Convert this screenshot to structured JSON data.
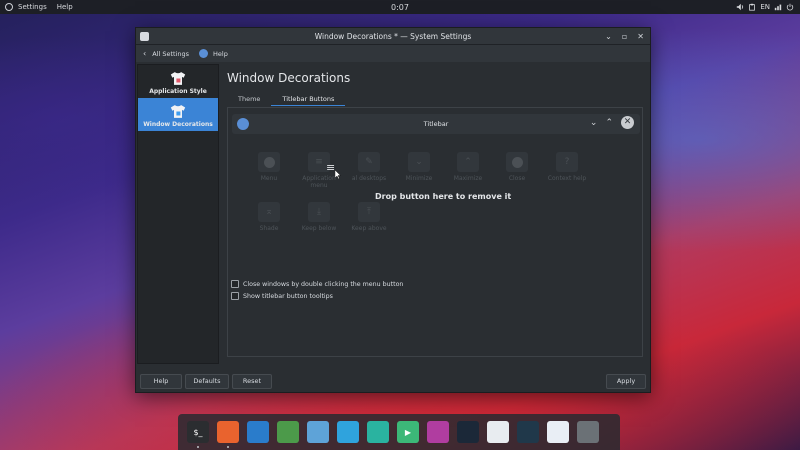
{
  "topbar": {
    "menu_settings": "Settings",
    "menu_help": "Help",
    "clock": "0:07",
    "lang": "EN"
  },
  "window": {
    "title": "Window Decorations * — System Settings",
    "nav_all_settings": "All Settings",
    "nav_help": "Help"
  },
  "sidebar": {
    "items": [
      {
        "label": "Application Style"
      },
      {
        "label": "Window Decorations"
      }
    ]
  },
  "main": {
    "title": "Window Decorations",
    "tabs": [
      {
        "label": "Theme"
      },
      {
        "label": "Titlebar Buttons"
      }
    ],
    "preview_title": "Titlebar",
    "drop_message": "Drop button here to remove it",
    "available_buttons": [
      {
        "label": "Menu"
      },
      {
        "label": "Application\nmenu"
      },
      {
        "label": "al desktops"
      },
      {
        "label": "Minimize"
      },
      {
        "label": "Maximize"
      },
      {
        "label": "Close"
      },
      {
        "label": "Context help"
      },
      {
        "label": "Shade"
      },
      {
        "label": "Keep below"
      },
      {
        "label": "Keep above"
      }
    ],
    "checkboxes": [
      {
        "label": "Close windows by double clicking the menu button",
        "checked": false
      },
      {
        "label": "Show titlebar button tooltips",
        "checked": false
      }
    ]
  },
  "footer": {
    "help": "Help",
    "defaults": "Defaults",
    "reset": "Reset",
    "apply": "Apply"
  },
  "dock": {
    "apps": [
      {
        "icon": "terminal-icon",
        "glyph": "$_",
        "color": "#2b2d30"
      },
      {
        "icon": "firefox-icon",
        "glyph": "",
        "color": "#e9632e"
      },
      {
        "icon": "vscode-icon",
        "glyph": "",
        "color": "#2a7ccb"
      },
      {
        "icon": "android-studio-icon",
        "glyph": "",
        "color": "#4c9a4a"
      },
      {
        "icon": "file-manager-icon",
        "glyph": "",
        "color": "#5ea3d8"
      },
      {
        "icon": "telegram-icon",
        "glyph": "",
        "color": "#2fa3dd"
      },
      {
        "icon": "tv-app-icon",
        "glyph": "",
        "color": "#2ab3a0"
      },
      {
        "icon": "media-player-icon",
        "glyph": "▶",
        "color": "#3cb878"
      },
      {
        "icon": "image-viewer-icon",
        "glyph": "",
        "color": "#b03da0"
      },
      {
        "icon": "steam-icon",
        "glyph": "",
        "color": "#1b2838"
      },
      {
        "icon": "toggle-settings-icon",
        "glyph": "",
        "color": "#e8ecf0"
      },
      {
        "icon": "system-monitor-icon",
        "glyph": "",
        "color": "#20384a"
      },
      {
        "icon": "document-viewer-icon",
        "glyph": "",
        "color": "#e9eef5"
      },
      {
        "icon": "trash-icon",
        "glyph": "",
        "color": "#6b7176"
      }
    ]
  }
}
